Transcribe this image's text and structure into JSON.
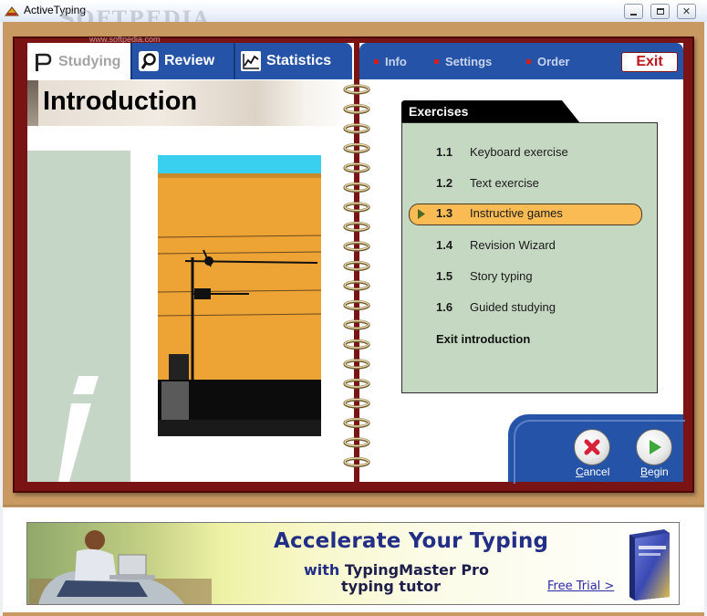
{
  "window": {
    "title": "ActiveTyping",
    "watermark": "SOFTPEDIA",
    "watermark_url": "www.softpedia.com"
  },
  "left_tabs": [
    {
      "label": "Studying",
      "icon": "studying-flag-icon",
      "active": true
    },
    {
      "label": "Review",
      "icon": "magnifier-icon",
      "active": false
    },
    {
      "label": "Statistics",
      "icon": "line-chart-icon",
      "active": false
    }
  ],
  "page": {
    "title": "Introduction",
    "side_glyph": "i"
  },
  "right_nav": [
    {
      "label": "Info"
    },
    {
      "label": "Settings"
    },
    {
      "label": "Order"
    }
  ],
  "exit_label": "Exit",
  "exercises": {
    "heading": "Exercises",
    "items": [
      {
        "num": "1.1",
        "label": "Keyboard exercise",
        "selected": false
      },
      {
        "num": "1.2",
        "label": "Text exercise",
        "selected": false
      },
      {
        "num": "1.3",
        "label": "Instructive games",
        "selected": true
      },
      {
        "num": "1.4",
        "label": "Revision Wizard",
        "selected": false
      },
      {
        "num": "1.5",
        "label": "Story typing",
        "selected": false
      },
      {
        "num": "1.6",
        "label": "Guided studying",
        "selected": false
      }
    ],
    "exit_label": "Exit introduction"
  },
  "controls": {
    "cancel_mnemonic": "C",
    "cancel_rest": "ancel",
    "begin_mnemonic": "B",
    "begin_rest": "egin"
  },
  "ad": {
    "headline": "Accelerate Your Typing",
    "line1_prefix": "with",
    "line1_product": "TypingMaster Pro",
    "line2": "typing tutor",
    "link": "Free Trial >"
  },
  "colors": {
    "tab_blue": "#2553a7",
    "book_red": "#7a1414",
    "panel_green": "#c5d9c2",
    "selected_orange": "#fbbb54",
    "frame_tan": "#c89a62"
  }
}
